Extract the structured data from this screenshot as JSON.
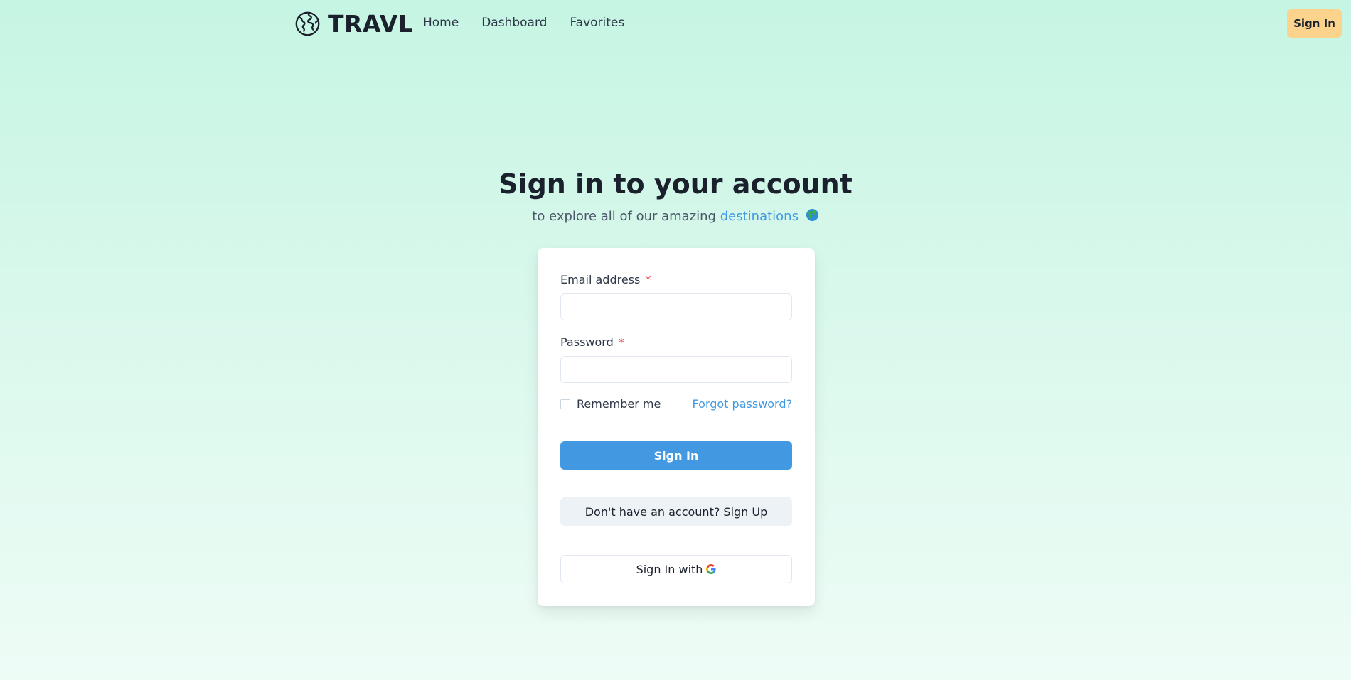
{
  "header": {
    "logo_text": "TRAVL",
    "logo_icon": "globe-icon",
    "nav": [
      {
        "label": "Home"
      },
      {
        "label": "Dashboard"
      },
      {
        "label": "Favorites"
      }
    ],
    "signin_label": "Sign In"
  },
  "main": {
    "title": "Sign in to your account",
    "subtitle_prefix": "to explore all of our amazing ",
    "subtitle_link": "destinations",
    "subtitle_icon": "earth-globe-emoji"
  },
  "form": {
    "email_label": "Email address",
    "email_value": "",
    "password_label": "Password",
    "password_value": "",
    "required_mark": "*",
    "remember_label": "Remember me",
    "remember_checked": false,
    "forgot_label": "Forgot password?",
    "signin_button": "Sign In",
    "signup_button": "Don't have an account? Sign Up",
    "google_button": "Sign In with",
    "google_icon": "google-g-icon"
  },
  "colors": {
    "accent": "#4299e1",
    "header_button": "#fbd38d",
    "required": "#e53e3e",
    "background_top": "#c6f5e3",
    "background_bottom": "#eefcf6"
  }
}
